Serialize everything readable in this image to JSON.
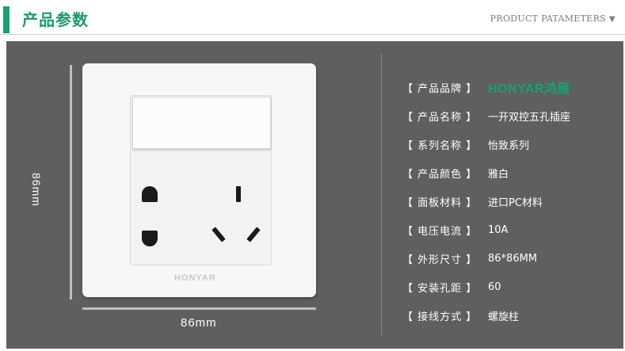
{
  "header": {
    "title": "产品参数",
    "en_title": "PRODUCT PATAMETERS",
    "arrow": "▼"
  },
  "dimensions": {
    "height_label": "86mm",
    "width_label": "86mm"
  },
  "product_image": {
    "brand_mark": "HONYAR"
  },
  "specs": [
    {
      "label": "【 产品品牌 】",
      "value": "HONYAR鸿雁"
    },
    {
      "label": "【 产品名称 】",
      "value": "一开双控五孔插座"
    },
    {
      "label": "【 系列名称 】",
      "value": "怡致系列"
    },
    {
      "label": "【 产品颜色 】",
      "value": "雅白"
    },
    {
      "label": "【 面板材料 】",
      "value": "进口PC材料"
    },
    {
      "label": "【 电压电流 】",
      "value": "10A"
    },
    {
      "label": "【 外形尺寸 】",
      "value": "86*86MM"
    },
    {
      "label": "【 安装孔距 】",
      "value": "60"
    },
    {
      "label": "【 接线方式 】",
      "value": "螺旋柱"
    }
  ],
  "colors": {
    "accent": "#1aa06f",
    "panel": "#5f5f5f"
  }
}
